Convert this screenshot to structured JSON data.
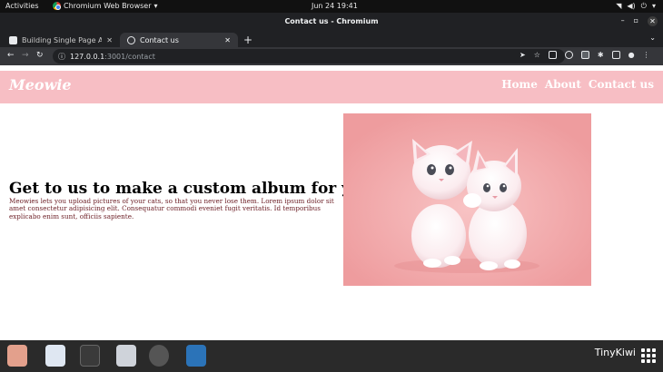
{
  "system_bar": {
    "activities": "Activities",
    "app_name": "Chromium Web Browser",
    "clock": "Jun 24  19:41"
  },
  "window": {
    "title": "Contact us - Chromium"
  },
  "tabs": [
    {
      "label": "Building Single Page App",
      "active": false
    },
    {
      "label": "Contact us",
      "active": true
    }
  ],
  "address_bar": {
    "host": "127.0.0.1",
    "path": ":3001/contact"
  },
  "site": {
    "brand": "Meowie",
    "nav": [
      "Home",
      "About",
      "Contact us"
    ],
    "heading": "Get to us to make a custom album for your cat",
    "body": "Meowies lets you upload pictures of your cats, so that you never lose them. Lorem ipsum dolor sit amet consectetur adipisicing elit. Consequatur commodi eveniet fugit veritatis. Id temporibus explicabo enim sunt, officiis sapiente.",
    "header_color": "#f7bec4",
    "text_color": "#6b1d24"
  },
  "dock": {
    "watermark": "TinyKiwi"
  }
}
